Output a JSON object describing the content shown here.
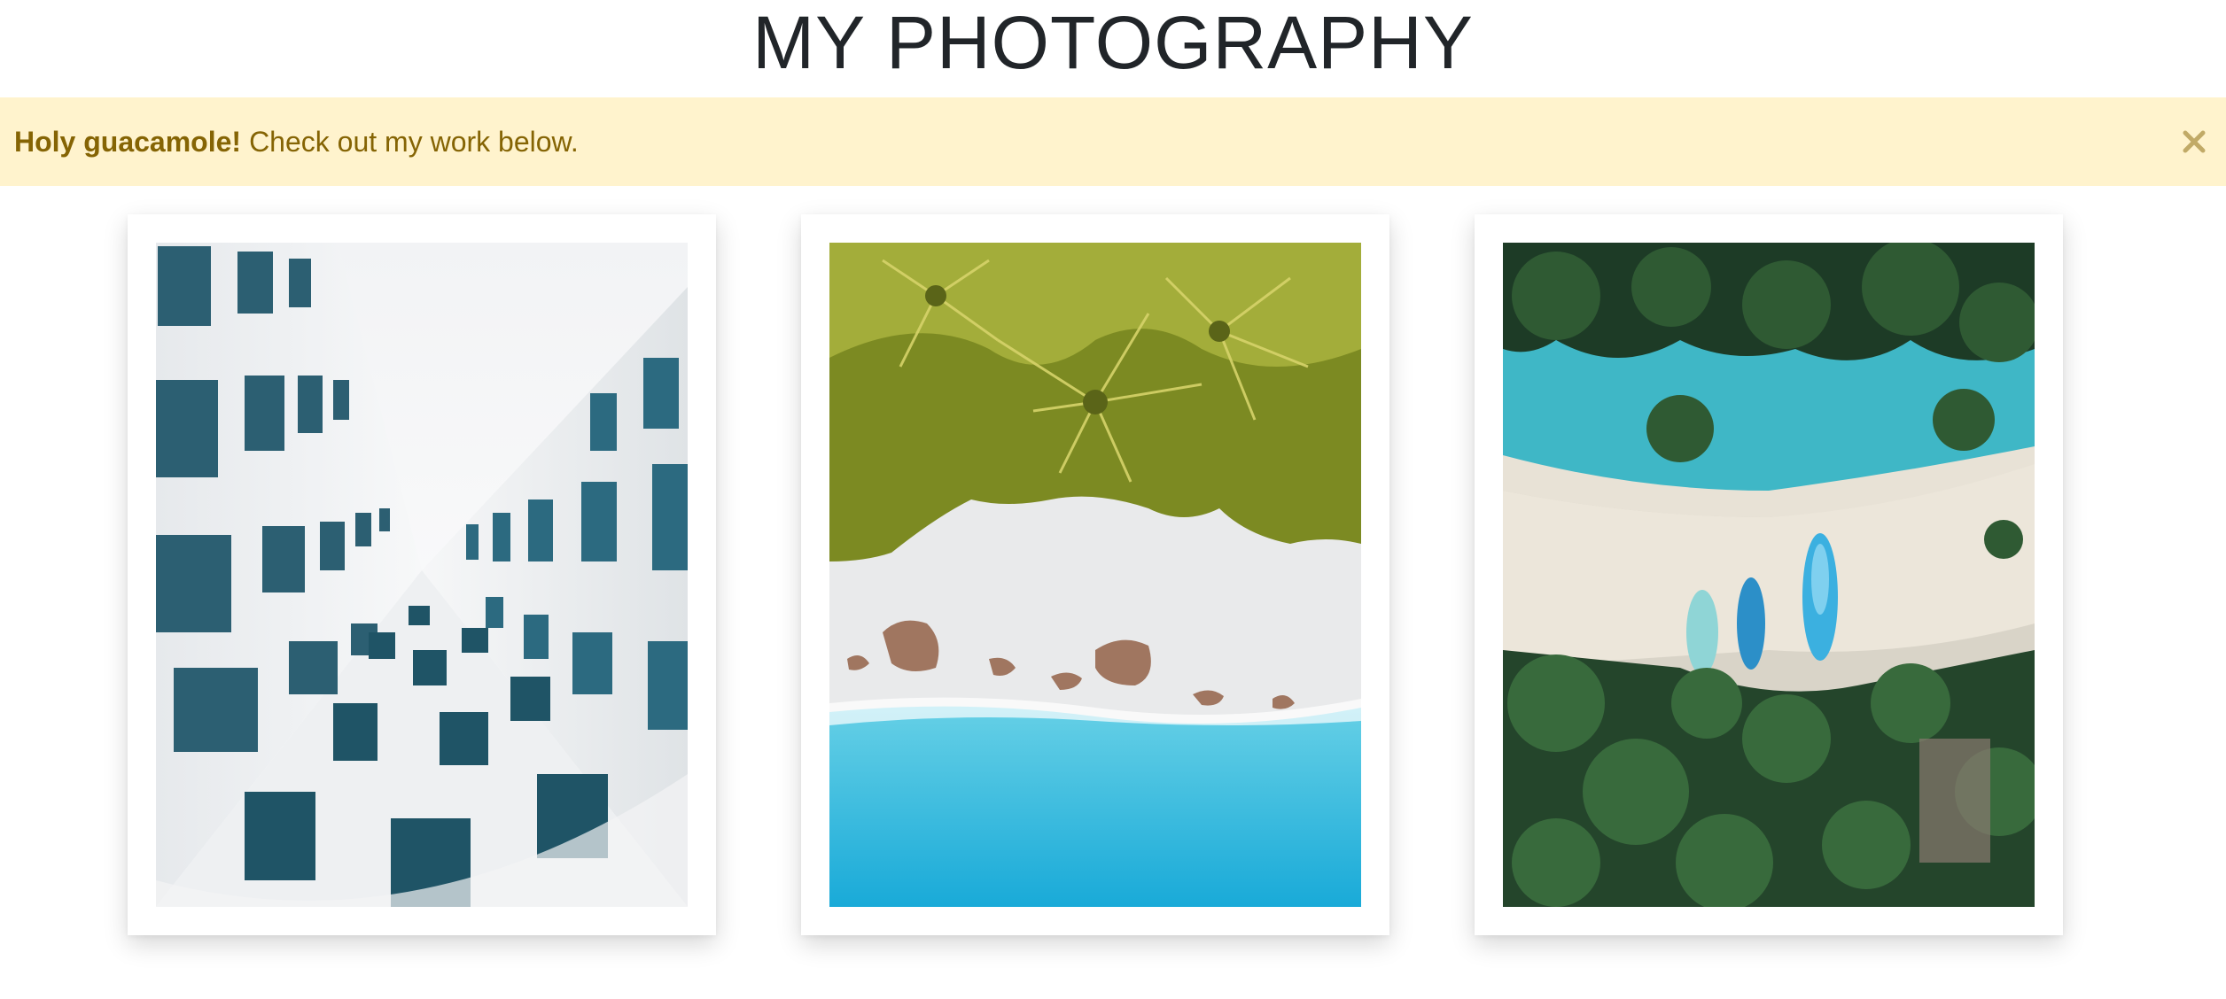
{
  "page": {
    "title": "MY PHOTOGRAPHY"
  },
  "alert": {
    "strong_text": "Holy guacamole!",
    "message": "Check out my work below.",
    "close_icon": "close-icon",
    "background": "#fff3cd",
    "text_color": "#856404"
  },
  "gallery": {
    "photos": [
      {
        "subject": "architecture-upward-view"
      },
      {
        "subject": "aerial-beach-palms"
      },
      {
        "subject": "aerial-beach-boats"
      }
    ]
  }
}
